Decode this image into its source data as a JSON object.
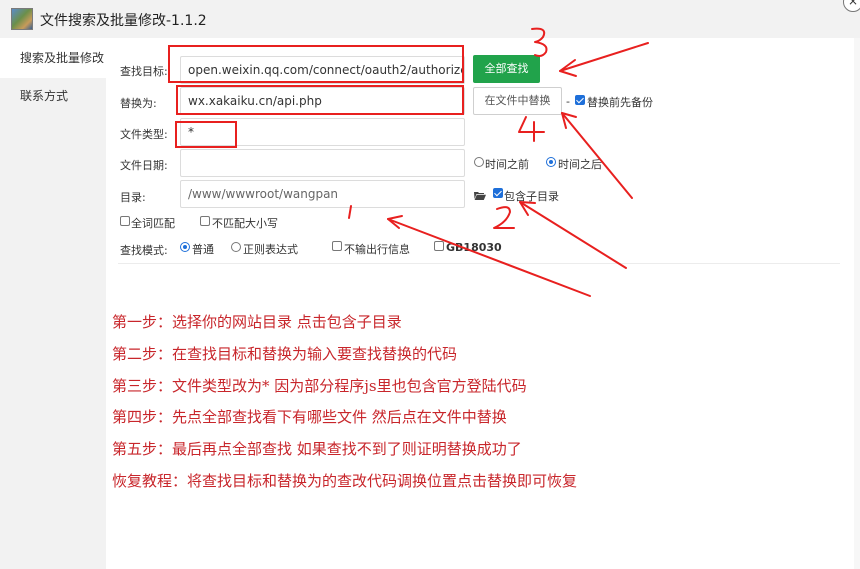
{
  "window": {
    "title": "文件搜索及批量修改-1.1.2",
    "close_icon": "×"
  },
  "sidebar": {
    "tabs": [
      {
        "label": "搜索及批量修改",
        "active": true
      },
      {
        "label": "联系方式",
        "active": false
      }
    ]
  },
  "form": {
    "search_target": {
      "label": "查找目标:",
      "value": "open.weixin.qq.com/connect/oauth2/authorize"
    },
    "replace_with": {
      "label": "替换为:",
      "value": "wx.xakaiku.cn/api.php"
    },
    "file_type": {
      "label": "文件类型:",
      "value": "*"
    },
    "file_date": {
      "label": "文件日期:",
      "value": "",
      "before_label": "时间之前",
      "after_label": "时间之后",
      "selected": "after"
    },
    "directory": {
      "label": "目录:",
      "placeholder": "/www/wwwroot/wangpan",
      "include_subdirs_label": "包含子目录",
      "include_subdirs": true
    },
    "whole_word": {
      "label": "全词匹配",
      "checked": false
    },
    "ignore_case": {
      "label": "不匹配大小写",
      "checked": false
    },
    "search_mode": {
      "label": "查找模式:",
      "normal_label": "普通",
      "regex_label": "正则表达式",
      "selected": "normal"
    },
    "no_line_info": {
      "label": "不输出行信息",
      "checked": false
    },
    "gb18030": {
      "label": "GB18030",
      "checked": false
    },
    "search_all_button": "全部查找",
    "replace_in_file_button": "在文件中替换",
    "dash": "-",
    "backup_label": "替换前先备份",
    "backup_checked": true
  },
  "instructions": [
    "第一步：选择你的网站目录 点击包含子目录",
    "第二步：在查找目标和替换为输入要查找替换的代码",
    "第三步：文件类型改为* 因为部分程序js里也包含官方登陆代码",
    "第四步：先点全部查找看下有哪些文件 然后点在文件中替换",
    "第五步：最后再点全部查找 如果查找不到了则证明替换成功了",
    "恢复教程：将查找目标和替换为的查改代码调换位置点击替换即可恢复"
  ],
  "annotations": {
    "color": "#e8201f",
    "numbers": [
      "1",
      "2",
      "3",
      "4"
    ]
  },
  "colors": {
    "accent_green": "#21a34b",
    "instruction_red": "#c8262b",
    "checkbox_blue": "#1e6fd9"
  }
}
